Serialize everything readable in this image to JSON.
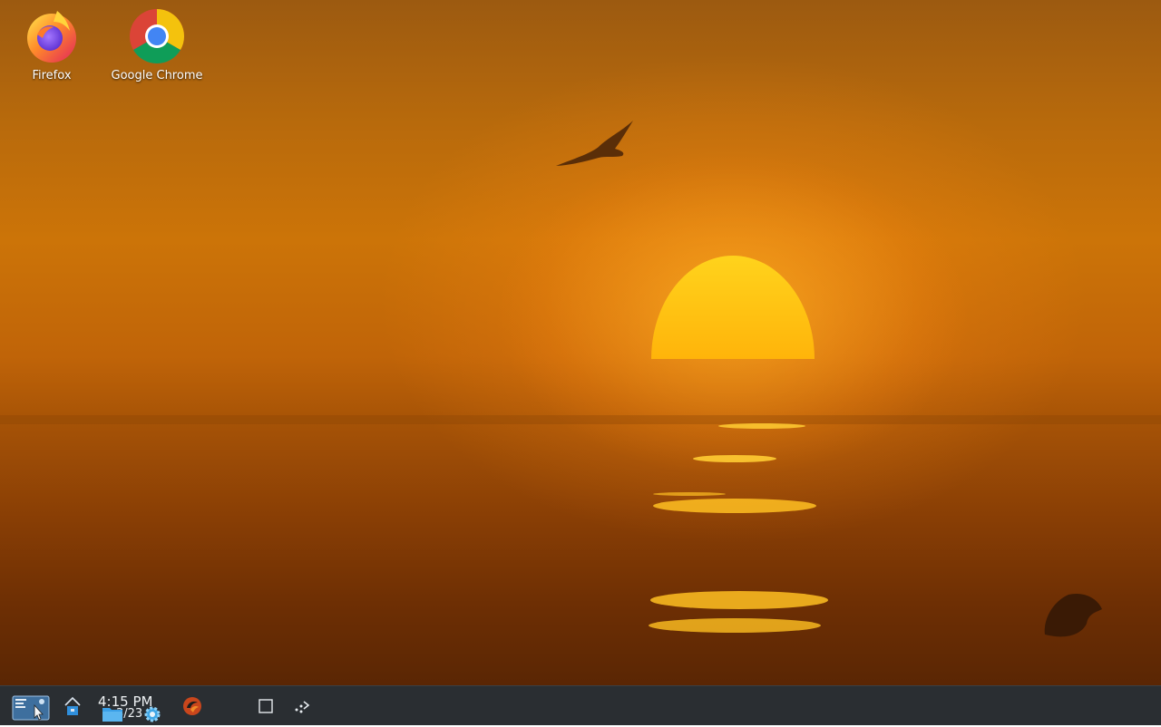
{
  "desktop": {
    "icons": [
      {
        "name": "firefox",
        "label": "Firefox"
      },
      {
        "name": "google-chrome",
        "label": "Google Chrome"
      }
    ],
    "wallpaper": "sunset-over-sea"
  },
  "taskbar": {
    "clock": {
      "time": "4:15 PM",
      "date": "3/23"
    },
    "items": [
      {
        "name": "application-launcher",
        "icon": "launcher-icon"
      },
      {
        "name": "home",
        "icon": "home-icon"
      },
      {
        "name": "files",
        "icon": "folder-icon"
      },
      {
        "name": "settings",
        "icon": "gear-icon"
      },
      {
        "name": "app",
        "icon": "swirl-app-icon"
      },
      {
        "name": "show-desktop",
        "icon": "square-icon"
      },
      {
        "name": "more",
        "icon": "dots-arrow-icon"
      }
    ]
  },
  "colors": {
    "taskbar_bg": "#2a2e32",
    "sun": "#ffd21a",
    "sky_mid": "#cc7408",
    "sea_dark": "#5a2604"
  }
}
